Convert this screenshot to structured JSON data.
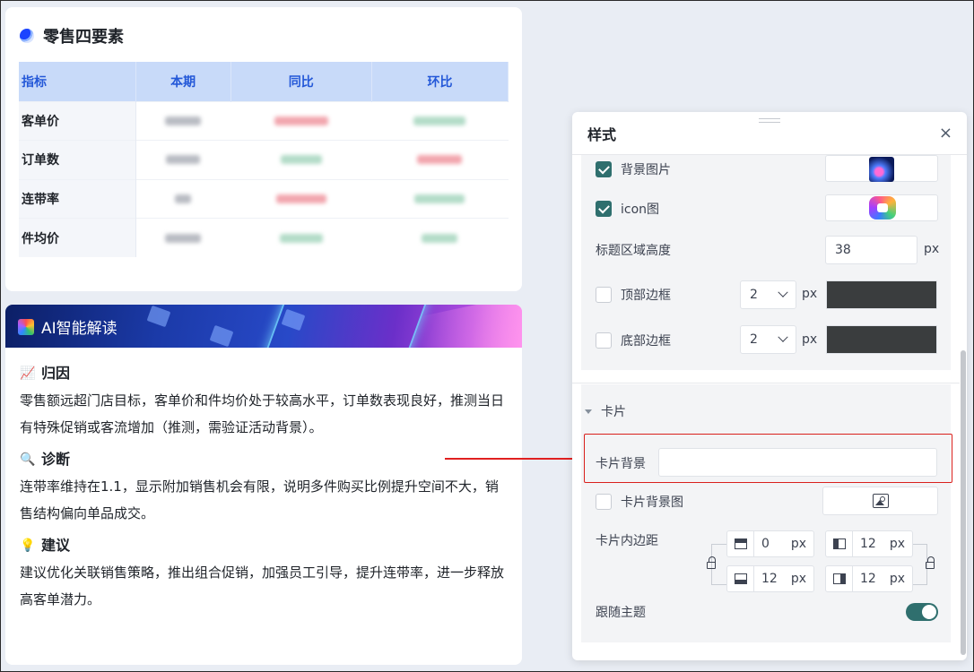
{
  "retail": {
    "title": "零售四要素",
    "columns": [
      "指标",
      "本期",
      "同比",
      "环比"
    ],
    "rows": [
      {
        "label": "客单价"
      },
      {
        "label": "订单数"
      },
      {
        "label": "连带率"
      },
      {
        "label": "件均价"
      }
    ]
  },
  "ai": {
    "title": "AI智能解读",
    "sections": [
      {
        "icon": "📈",
        "heading": "归因",
        "text": "零售额远超门店目标，客单价和件均价处于较高水平，订单数表现良好，推测当日有特殊促销或客流增加（推测，需验证活动背景）。"
      },
      {
        "icon": "🔍",
        "heading": "诊断",
        "text": "连带率维持在1.1，显示附加销售机会有限，说明多件购买比例提升空间不大，销售结构偏向单品成交。"
      },
      {
        "icon": "💡",
        "heading": "建议",
        "text": "建议优化关联销售策略，推出组合促销，加强员工引导，提升连带率，进一步释放高客单潜力。"
      }
    ]
  },
  "panel": {
    "title": "样式",
    "close": "×",
    "bg_image_label": "背景图片",
    "icon_image_label": "icon图",
    "title_height_label": "标题区域高度",
    "title_height_value": "38",
    "unit_px": "px",
    "top_border_label": "顶部边框",
    "top_border_value": "2",
    "bottom_border_label": "底部边框",
    "bottom_border_value": "2",
    "border_color": "#3a3d3e",
    "card_section_title": "卡片",
    "card_bg_label": "卡片背景",
    "card_bg_value": "",
    "card_bg_image_label": "卡片背景图",
    "card_padding_label": "卡片内边距",
    "padding_top": "0",
    "padding_left": "12",
    "padding_bottom": "12",
    "padding_right": "12",
    "follow_theme_label": "跟随主题",
    "accent": "#2f6f6e"
  }
}
